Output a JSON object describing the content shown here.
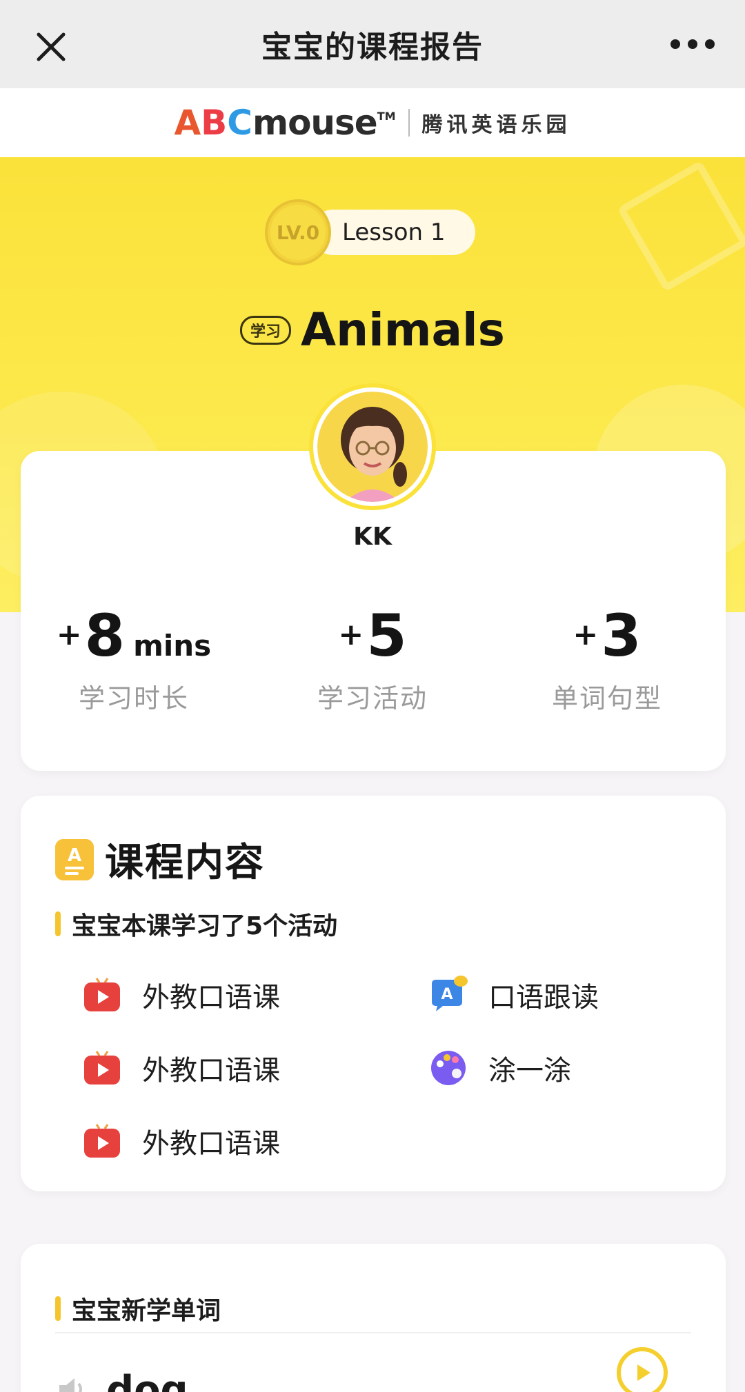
{
  "navbar": {
    "title": "宝宝的课程报告",
    "close_icon": "close-icon",
    "more_icon": "more-icon"
  },
  "brand": {
    "logo_letters": [
      "A",
      "B",
      "C"
    ],
    "logo_rest": "mouse",
    "logo_tm": "TM",
    "cn_name": "腾讯英语乐园"
  },
  "hero": {
    "level": "LV.0",
    "lesson": "Lesson 1",
    "tag": "学习",
    "title": "Animals"
  },
  "profile": {
    "name": "KK"
  },
  "stats": [
    {
      "plus": "+",
      "value": "8",
      "unit": "mins",
      "label": "学习时长"
    },
    {
      "plus": "+",
      "value": "5",
      "unit": "",
      "label": "学习活动"
    },
    {
      "plus": "+",
      "value": "3",
      "unit": "",
      "label": "单词句型"
    }
  ],
  "course": {
    "title": "课程内容",
    "subtitle": "宝宝本课学习了5个活动",
    "activities": [
      {
        "label": "外教口语课",
        "icon": "video-icon"
      },
      {
        "label": "口语跟读",
        "icon": "speech-bubble-icon"
      },
      {
        "label": "外教口语课",
        "icon": "video-icon"
      },
      {
        "label": "涂一涂",
        "icon": "palette-icon"
      },
      {
        "label": "外教口语课",
        "icon": "video-icon"
      }
    ]
  },
  "words": {
    "title": "宝宝新学单词",
    "items": [
      {
        "word": "dog"
      }
    ]
  },
  "colors": {
    "accent_yellow": "#fbe23a",
    "bar_yellow": "#f5c52e",
    "video_red": "#e6413d",
    "speech_blue": "#3c86e6",
    "palette_purple": "#7b5cf0"
  }
}
